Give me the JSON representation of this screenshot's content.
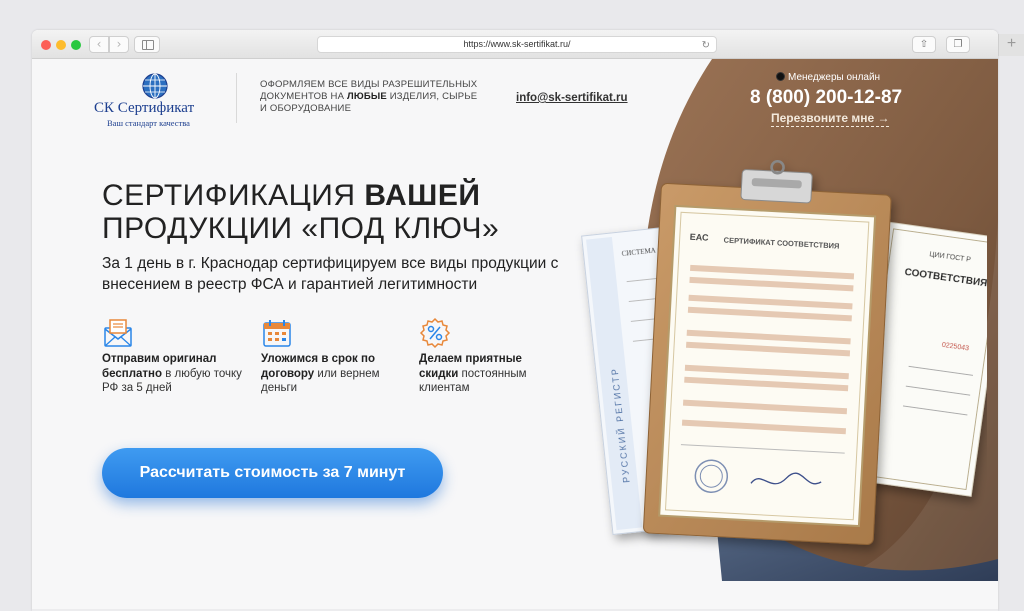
{
  "browser": {
    "url": "https://www.sk-sertifikat.ru/",
    "back_label": "‹",
    "forward_label": "›"
  },
  "header": {
    "logo_title": "СК Сертификат",
    "logo_subtitle": "Ваш стандарт качества",
    "tagline_part1": "ОФОРМЛЯЕМ ВСЕ ВИДЫ РАЗРЕШИТЕЛЬНЫХ ДОКУМЕНТОВ НА ",
    "tagline_bold": "ЛЮБЫЕ",
    "tagline_part2": " ИЗДЕЛИЯ, СЫРЬЕ И ОБОРУДОВАНИЕ",
    "email": "info@sk-sertifikat.ru",
    "online_text": "Менеджеры онлайн",
    "phone": "8 (800) 200-12-87",
    "callback": "Перезвоните мне →"
  },
  "hero": {
    "title_regular": "СЕРТИФИКАЦИЯ ",
    "title_bold": "ВАШЕЙ",
    "title_line2": "ПРОДУКЦИИ «ПОД КЛЮЧ»",
    "description": "За 1 день в г. Краснодар сертифицируем все виды продукции с внесением в реестр ФСА и гарантией легитимности",
    "cta": "Рассчитать стоимость за 7 минут"
  },
  "features": [
    {
      "icon": "envelope-icon",
      "bold": "Отправим оригинал бесплатно",
      "rest": " в любую точку РФ за 5 дней"
    },
    {
      "icon": "calendar-icon",
      "bold": "Уложимся в срок по договору",
      "rest": " или вернем деньги"
    },
    {
      "icon": "discount-icon",
      "bold": "Делаем приятные скидки",
      "rest": " постоянным клиентам"
    }
  ],
  "documents": {
    "main_title": "СЕРТИФИКАТ СООТВЕТСТВИЯ",
    "eac": "ЕАС",
    "left_header": "СИСТЕМА СЕРТИФИКАЦИИ",
    "left_side": "РУССКИЙ РЕГИСТР",
    "right_title": "СООТВЕТСТВИЯ",
    "right_header": "ЦИИ ГОСТ Р",
    "right_number": "0225043"
  },
  "colors": {
    "accent_blue": "#2a86e8",
    "brown": "#8a6448",
    "logo_blue": "#1d3f8f"
  }
}
